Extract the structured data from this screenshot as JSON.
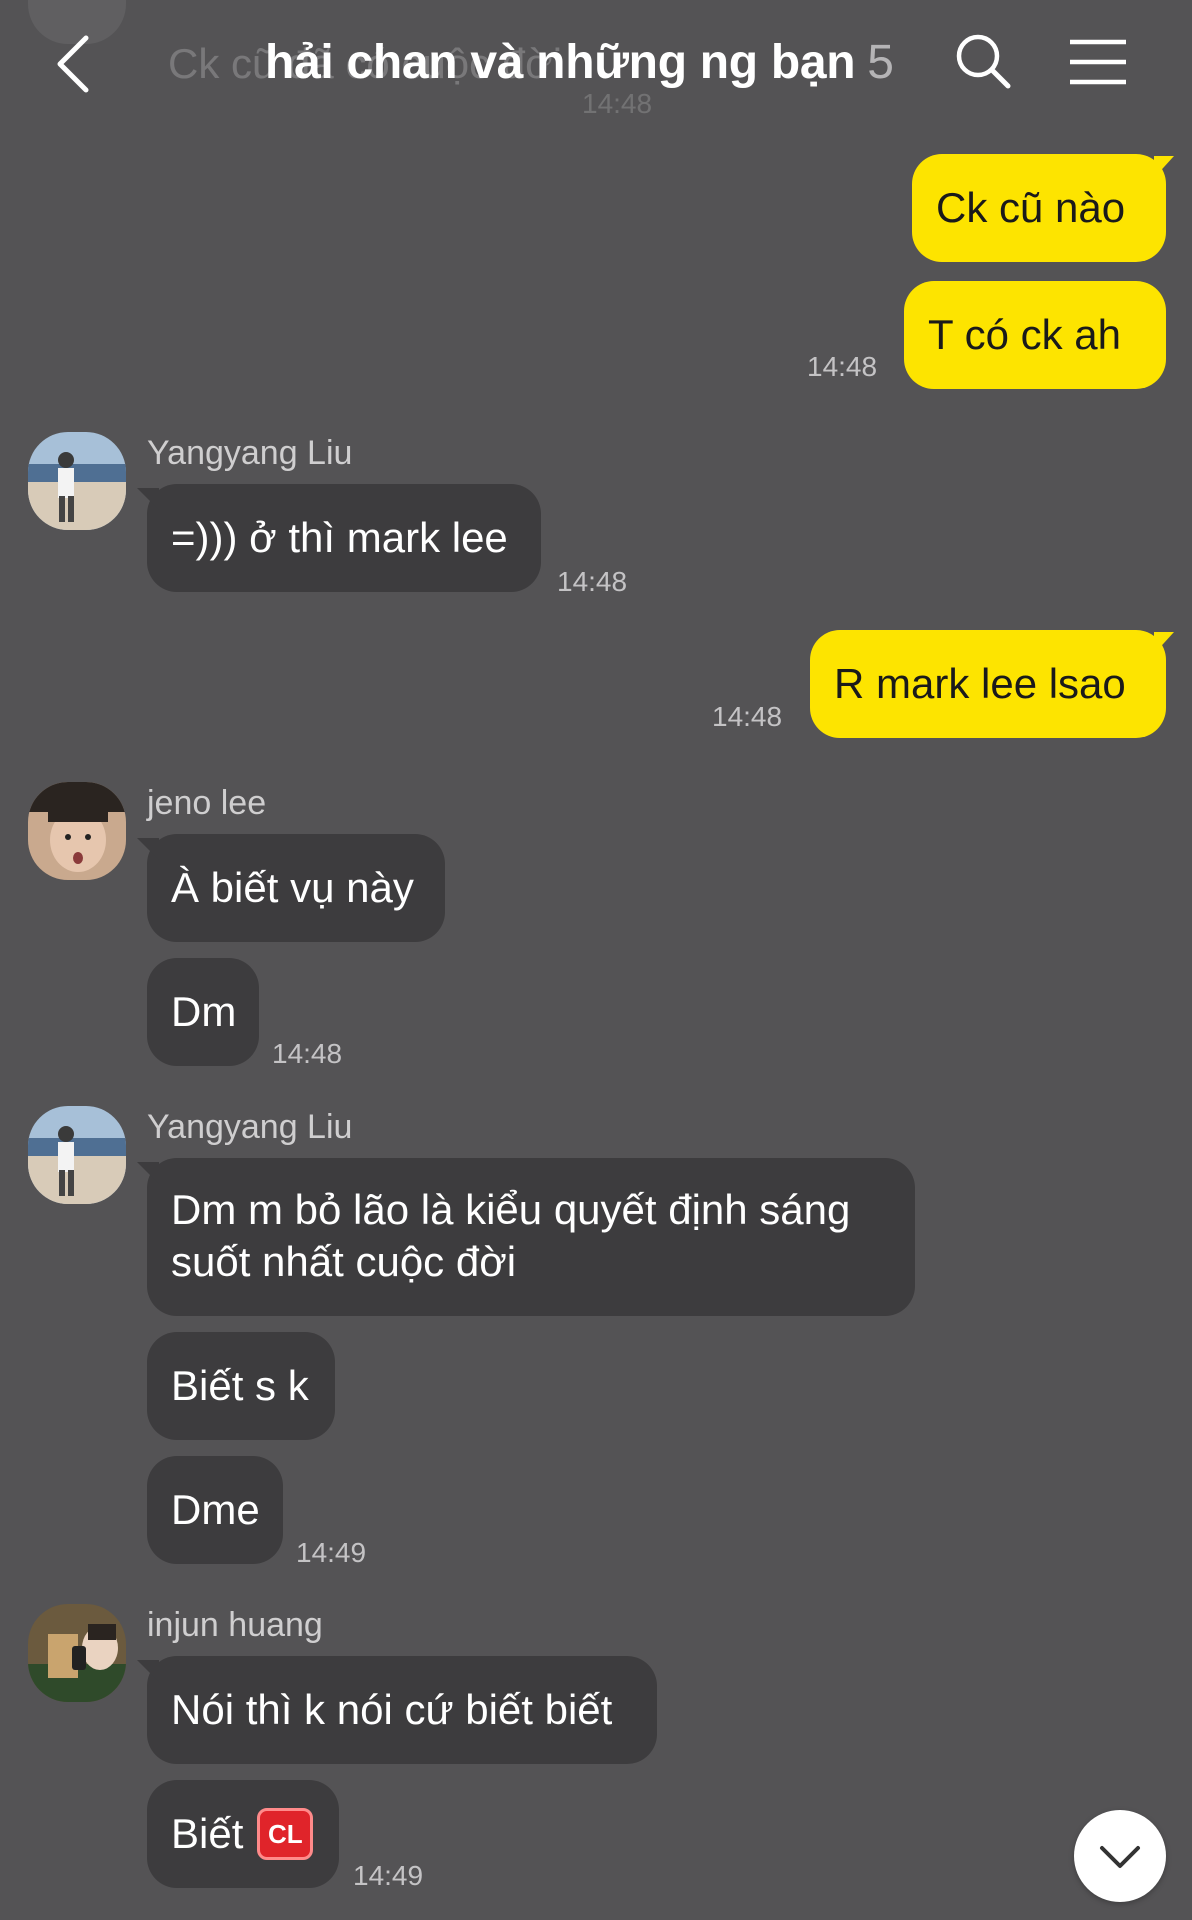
{
  "header": {
    "ghost_text": "Ck cũ đã có cuộc đời",
    "ghost_time": "14:48",
    "title": "hải chan và những ng bạn",
    "member_count": "5",
    "icons": {
      "back": "chevron-left-icon",
      "search": "search-icon",
      "menu": "hamburger-menu-icon"
    }
  },
  "colors": {
    "background": "#545355",
    "mine_bubble": "#fde400",
    "their_bubble": "#3d3c3e"
  },
  "messages": {
    "m1": {
      "text": "Ck cũ nào"
    },
    "m2": {
      "text": "T có ck ah",
      "time": "14:48"
    },
    "g1": {
      "sender": "Yangyang Liu",
      "text": "=))) ở thì mark lee",
      "time": "14:48"
    },
    "m3": {
      "text": "R mark lee lsao",
      "time": "14:48"
    },
    "g2": {
      "sender": "jeno lee",
      "text1": "À biết vụ này",
      "text2": "Dm",
      "time": "14:48"
    },
    "g3": {
      "sender": "Yangyang Liu",
      "text1": "Dm m bỏ lão là kiểu quyết định sáng suốt nhất cuộc đời",
      "text2": "Biết s k",
      "text3": "Dme",
      "time": "14:49"
    },
    "g4": {
      "sender": "injun huang",
      "text1": "Nói thì k nói cứ biết biết",
      "text2": "Biết",
      "badge": "CL",
      "time": "14:49"
    }
  },
  "scroll_button": {
    "icon": "chevron-down-icon"
  }
}
